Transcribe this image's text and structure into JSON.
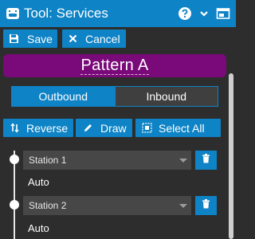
{
  "window": {
    "title": "Tool: Services",
    "accent": "#0e83c6",
    "icons": [
      "gamepad-icon",
      "help-icon",
      "chevron-down-icon",
      "dock-window-icon"
    ]
  },
  "actions": {
    "save_label": "Save",
    "cancel_label": "Cancel"
  },
  "pattern": {
    "name": "Pattern A",
    "color": "#7a0a7a"
  },
  "direction": {
    "options": [
      "Outbound",
      "Inbound"
    ],
    "selected": "Outbound"
  },
  "tools": {
    "reverse_label": "Reverse",
    "draw_label": "Draw",
    "select_all_label": "Select All"
  },
  "stops": [
    {
      "name": "Station 1",
      "timing": "Auto"
    },
    {
      "name": "Station 2",
      "timing": "Auto"
    }
  ]
}
